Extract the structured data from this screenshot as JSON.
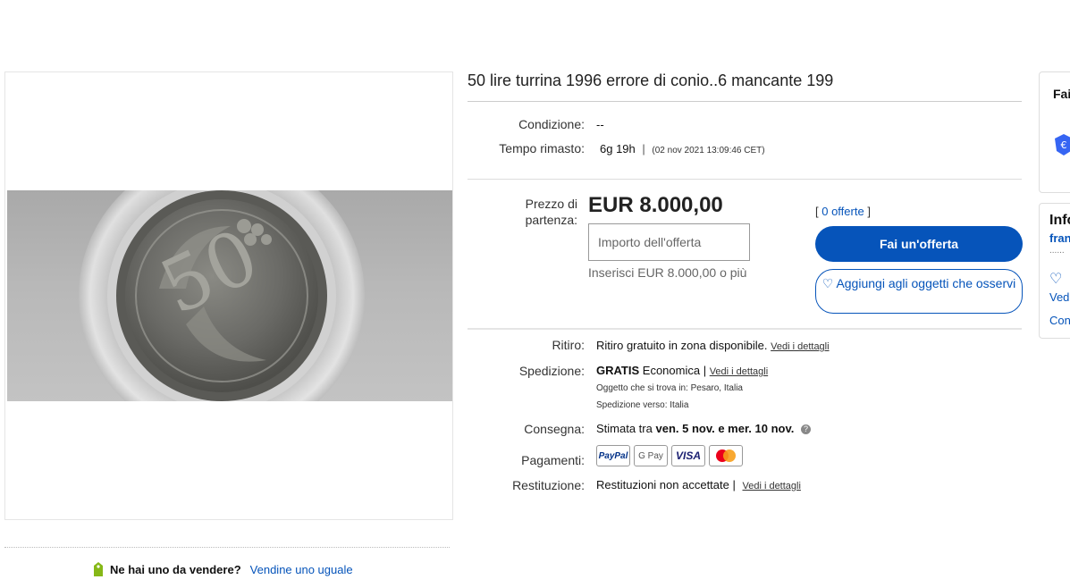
{
  "listing": {
    "title": "50 lire turrina 1996 errore di conio..6 mancante 199"
  },
  "details": {
    "condition_label": "Condizione:",
    "condition_value": "--",
    "time_label": "Tempo rimasto:",
    "time_value": "6g 19h",
    "time_end": "(02 nov 2021   13:09:46 CET)"
  },
  "offer": {
    "start_price_label": "Prezzo di partenza:",
    "price": "EUR 8.000,00",
    "input_placeholder": "Importo dell'offerta",
    "input_hint": "Inserisci EUR 8.000,00 o più",
    "offers_count": "0 offerte",
    "make_offer_button": "Fai un'offerta",
    "watch_button": "Aggiungi agli oggetti che osservi"
  },
  "shipping": {
    "pickup_label": "Ritiro:",
    "pickup_value": "Ritiro gratuito in zona disponibile.",
    "details_link": "Vedi i dettagli",
    "shipping_label": "Spedizione:",
    "shipping_free": "GRATIS",
    "shipping_type": "Economica |",
    "item_location": "Oggetto che si trova in:  Pesaro, Italia",
    "ships_to": "Spedizione verso:   Italia",
    "delivery_label": "Consegna:",
    "delivery_prefix": "Stimata tra",
    "delivery_range": "ven. 5 nov. e mer. 10 nov.",
    "payments_label": "Pagamenti:",
    "payment_methods": [
      "PayPal",
      "G Pay",
      "VISA",
      "mastercard"
    ],
    "returns_label": "Restituzione:",
    "returns_value": "Restituzioni non accettate |"
  },
  "sell": {
    "question": "Ne hai uno da vendere?",
    "link": "Vendine uno uguale"
  },
  "side": {
    "card1_title": "Fai",
    "card2_title": "Info",
    "card2_link": "fran",
    "card2_more": "......",
    "card2_view": "Ved",
    "card2_contact": "Con"
  },
  "colors": {
    "accent": "#0654ba",
    "text": "#111111"
  }
}
